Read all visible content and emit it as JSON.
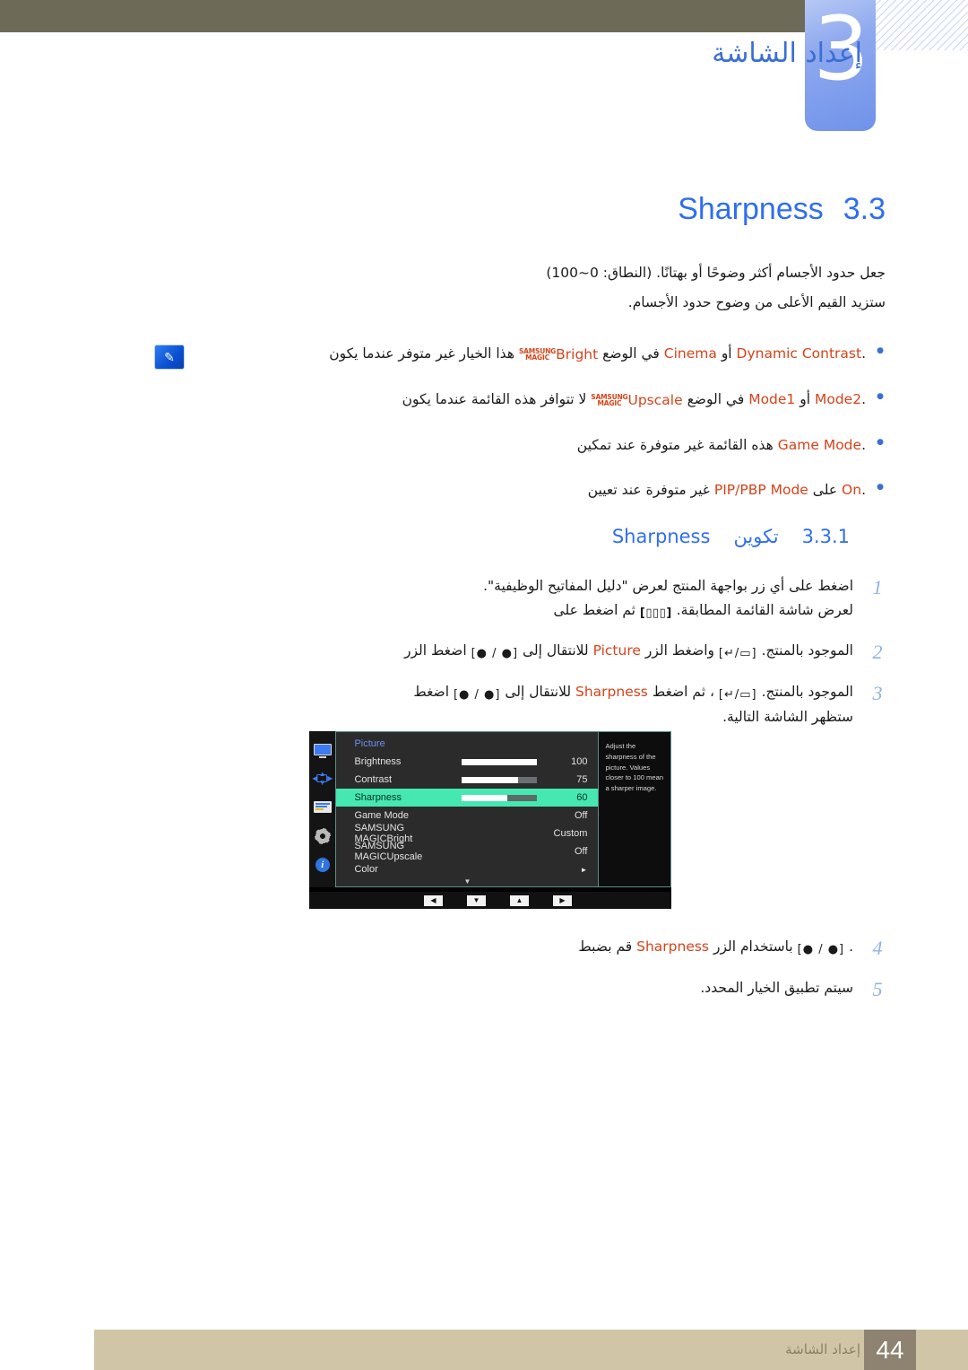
{
  "header": {
    "chapter_number": "3",
    "chapter_title": "إعداد الشاشة"
  },
  "section": {
    "number": "3.3",
    "title": "Sharpness",
    "intro_line1": "جعل حدود الأجسام أكثر وضوحًا أو بهتانًا. (النطاق: 0~100)",
    "intro_line2": "ستزيد القيم الأعلى من وضوح حدود الأجسام."
  },
  "notes": {
    "icon": "note-icon",
    "items": [
      {
        "prefix": "هذا الخيار غير متوفر عندما يكون",
        "magic_brand_top": "SAMSUNG",
        "magic_brand_bottom": "MAGIC",
        "magic_word": "Bright",
        "middle": "في الوضع",
        "term1": "Cinema",
        "conj": "أو",
        "term2": "Dynamic Contrast",
        "suffix": "."
      },
      {
        "prefix": "لا تتوافر هذه القائمة عندما يكون",
        "magic_brand_top": "SAMSUNG",
        "magic_brand_bottom": "MAGIC",
        "magic_word": "Upscale",
        "middle": "في الوضع",
        "term1": "Mode1",
        "conj": "أو",
        "term2": "Mode2",
        "suffix": "."
      },
      {
        "prefix": "هذه القائمة غير متوفرة عند تمكين",
        "term1": "Game Mode",
        "suffix": "."
      },
      {
        "prefix": "غير متوفرة عند تعيين",
        "term1": "PIP/PBP Mode",
        "middle": "على",
        "term2": "On",
        "suffix": "."
      }
    ]
  },
  "subsection": {
    "number": "3.3.1",
    "title_ar": "تكوين",
    "title_en": "Sharpness"
  },
  "steps_top": [
    {
      "num": "1",
      "line1": "اضغط على أي زر بواجهة المنتج لعرض \"دليل المفاتيح الوظيفية\".",
      "line2_pre": "ثم اضغط على",
      "line2_key": "[▯▯▯]",
      "line2_post": "لعرض شاشة القائمة المطابقة."
    },
    {
      "num": "2",
      "line1_a": "اضغط الزر",
      "key1": "[● / ●]",
      "line1_b": "للانتقال إلى",
      "term": "Picture",
      "line1_c": "واضغط الزر",
      "key2": "[↵/▭]",
      "line1_d": "الموجود بالمنتج."
    },
    {
      "num": "3",
      "line1_a": "اضغط",
      "key1": "[● / ●]",
      "line1_b": "للانتقال إلى",
      "term": "Sharpness",
      "line1_c": "، ثم اضغط",
      "key2": "[↵/▭]",
      "line1_d": "الموجود بالمنتج.",
      "line2": "ستظهر الشاشة التالية."
    }
  ],
  "steps_bottom": [
    {
      "num": "4",
      "line1_a": "قم بضبط",
      "term": "Sharpness",
      "line1_b": "باستخدام الزر",
      "key1": "[● / ●]",
      "line1_c": "."
    },
    {
      "num": "5",
      "line1_a": "سيتم تطبيق الخيار المحدد."
    }
  ],
  "osd": {
    "menu_title": "Picture",
    "sidebar_icons": [
      "monitor-icon",
      "dpad-icon",
      "list-icon",
      "gear-icon",
      "info-icon"
    ],
    "rows": [
      {
        "label": "Brightness",
        "value": "100",
        "slider": 100,
        "type": "slider",
        "selected": false
      },
      {
        "label": "Contrast",
        "value": "75",
        "slider": 75,
        "type": "slider",
        "selected": false
      },
      {
        "label": "Sharpness",
        "value": "60",
        "slider": 60,
        "type": "slider",
        "selected": true
      },
      {
        "label": "Game Mode",
        "value": "Off",
        "type": "value",
        "selected": false
      },
      {
        "label_magic_top": "SAMSUNG",
        "label_magic_bottom": "MAGIC",
        "label_magic_word": "Bright",
        "value": "Custom",
        "type": "magic",
        "selected": false
      },
      {
        "label_magic_top": "SAMSUNG",
        "label_magic_bottom": "MAGIC",
        "label_magic_word": "Upscale",
        "value": "Off",
        "type": "magic",
        "selected": false
      },
      {
        "label": "Color",
        "value": "►",
        "type": "submenu",
        "selected": false
      }
    ],
    "scroll_caret": "▼",
    "help_text": "Adjust the sharpness of the picture. Values closer to 100 mean a sharper image.",
    "buttons": [
      "◀",
      "▼",
      "▲",
      "▶"
    ],
    "highlight_color": "#45e8b0"
  },
  "footer": {
    "label": "إعداد الشاشة",
    "page": "44"
  }
}
